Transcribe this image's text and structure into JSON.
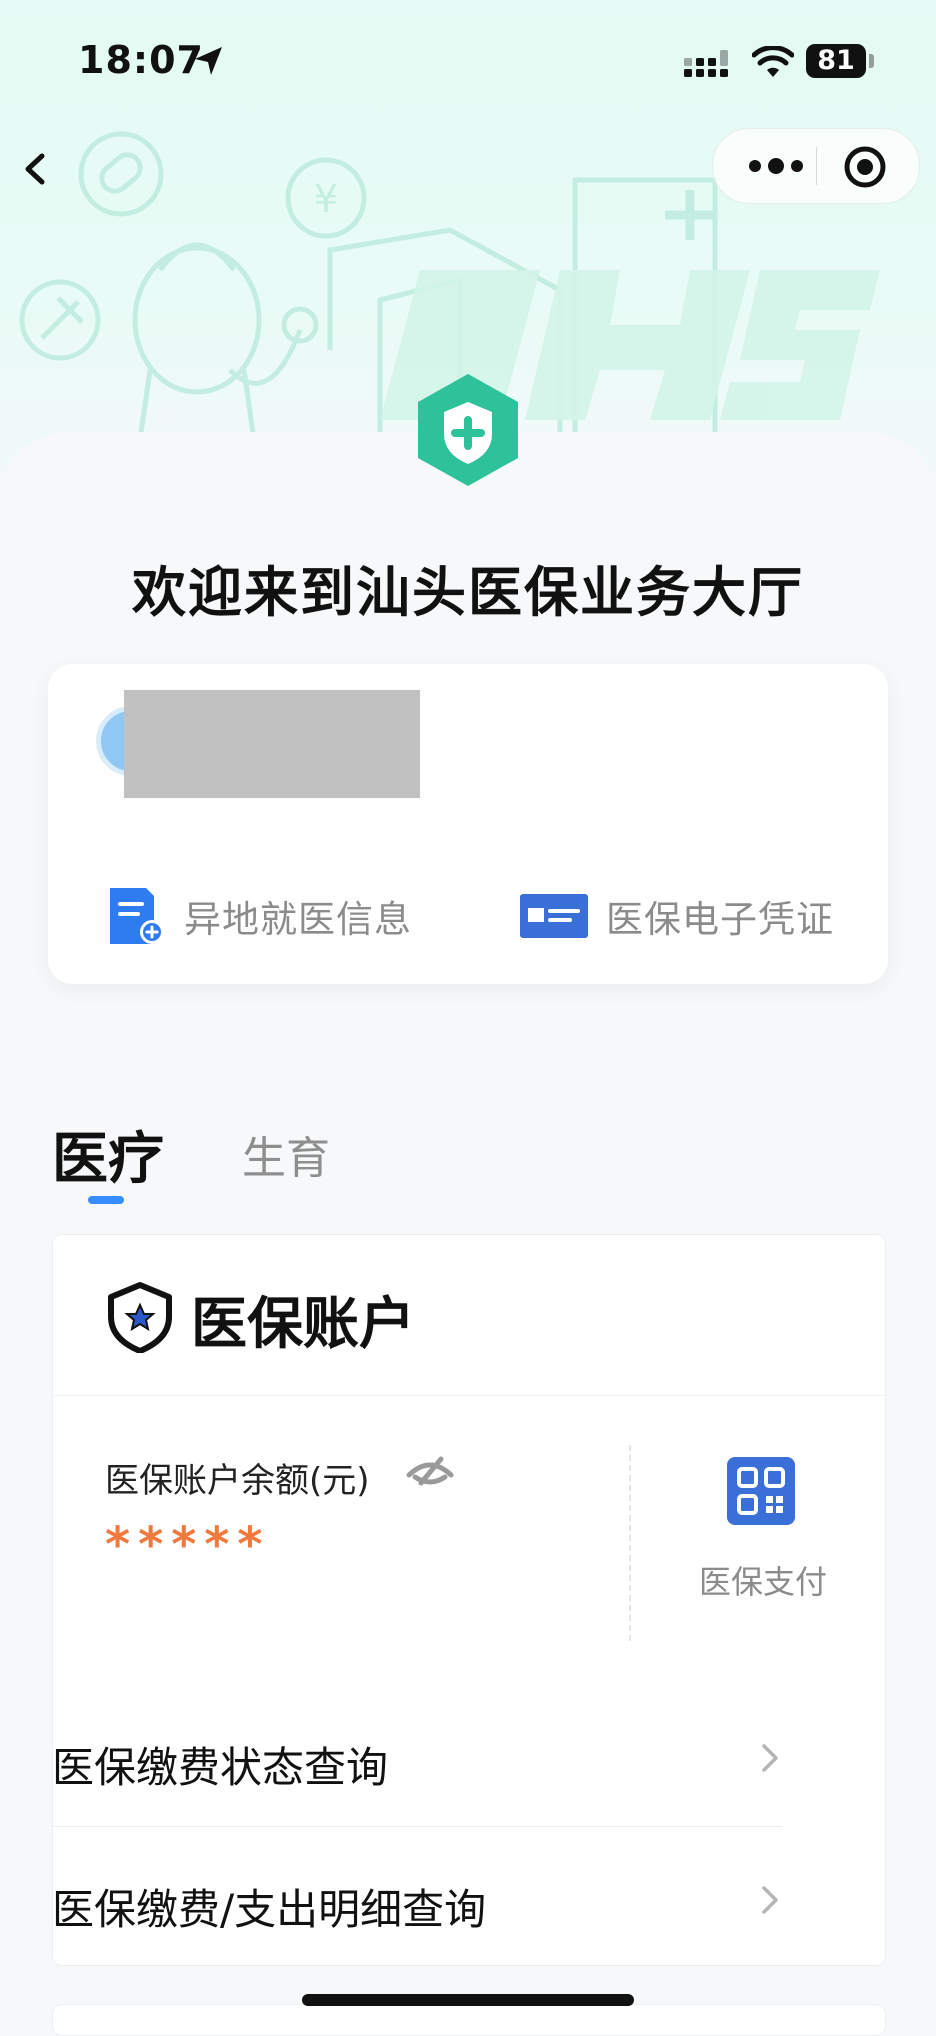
{
  "status_bar": {
    "time": "18:07",
    "battery": "81"
  },
  "page": {
    "title": "欢迎来到汕头医保业务大厅"
  },
  "user_card": {
    "links": [
      {
        "label": "异地就医信息",
        "icon": "document-plus-icon"
      },
      {
        "label": "医保电子凭证",
        "icon": "id-card-icon"
      }
    ]
  },
  "tabs": {
    "active": "医疗",
    "inactive": "生育"
  },
  "account": {
    "title": "医保账户",
    "balance_label": "医保账户余额(元)",
    "balance_value": "*****",
    "pay_label": "医保支付",
    "menu": [
      {
        "label": "医保缴费状态查询"
      },
      {
        "label": "医保缴费/支出明细查询"
      }
    ]
  },
  "colors": {
    "accent_green": "#2ec29a",
    "accent_blue": "#3a8dff",
    "balance_orange": "#f07a3e",
    "brand_blue": "#3b6fd8"
  }
}
